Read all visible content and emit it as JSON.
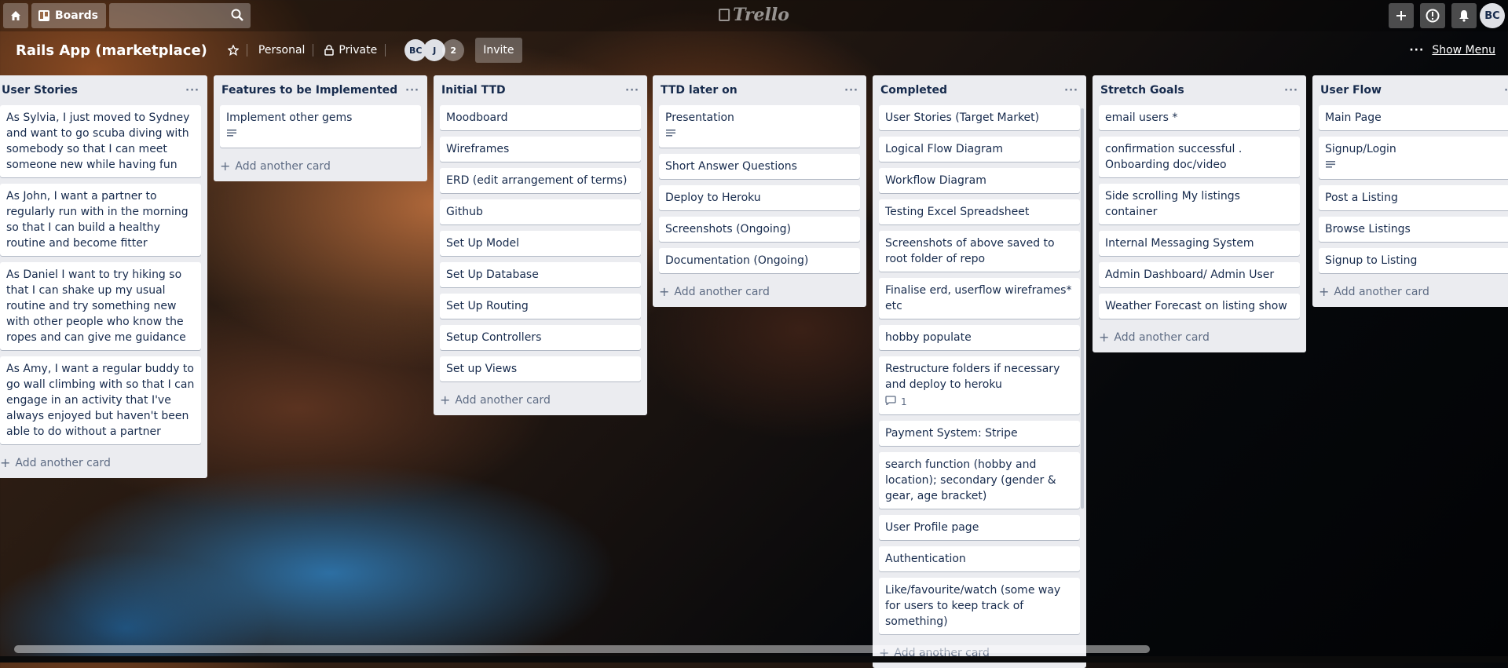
{
  "topbar": {
    "boards_label": "Boards",
    "logo_text": "Trello",
    "user_initials": "BC"
  },
  "board": {
    "title": "Rails App (marketplace)",
    "team": "Personal",
    "visibility": "Private",
    "members": [
      "BC",
      "J"
    ],
    "member_count": "2",
    "invite_label": "Invite",
    "show_menu_label": "Show Menu"
  },
  "add_card_label": "Add another card",
  "lists": [
    {
      "title": "User Stories",
      "cards": [
        {
          "text": "As Sylvia, I just moved to Sydney and want to go scuba diving with somebody so that I can meet someone new while having fun"
        },
        {
          "text": "As John, I want a partner to regularly run with in the morning so that I can build a healthy routine and become fitter"
        },
        {
          "text": "As Daniel I want to try hiking so that I can shake up my usual routine and try something new with other people who know the ropes and can give me guidance"
        },
        {
          "text": "As Amy, I want a regular buddy to go wall climbing with so that I can engage in an activity that I've always enjoyed but haven't been able to do without a partner"
        }
      ]
    },
    {
      "title": "Features to be Implemented",
      "cards": [
        {
          "text": "Implement other gems",
          "description_icon": true
        }
      ]
    },
    {
      "title": "Initial TTD",
      "cards": [
        {
          "text": "Moodboard"
        },
        {
          "text": "Wireframes"
        },
        {
          "text": "ERD (edit arrangement of terms)"
        },
        {
          "text": "Github"
        },
        {
          "text": "Set Up Model"
        },
        {
          "text": "Set Up Database"
        },
        {
          "text": "Set Up Routing"
        },
        {
          "text": "Setup Controllers"
        },
        {
          "text": "Set up Views"
        }
      ]
    },
    {
      "title": "TTD later on",
      "cards": [
        {
          "text": "Presentation",
          "description_icon": true
        },
        {
          "text": "Short Answer Questions"
        },
        {
          "text": "Deploy to Heroku"
        },
        {
          "text": "Screenshots (Ongoing)"
        },
        {
          "text": "Documentation (Ongoing)"
        }
      ]
    },
    {
      "title": "Completed",
      "cards": [
        {
          "text": "User Stories (Target Market)"
        },
        {
          "text": "Logical Flow Diagram"
        },
        {
          "text": "Workflow Diagram"
        },
        {
          "text": "Testing Excel Spreadsheet"
        },
        {
          "text": "Screenshots of above saved to root folder of repo"
        },
        {
          "text": "Finalise erd, userflow wireframes* etc"
        },
        {
          "text": "hobby populate"
        },
        {
          "text": "Restructure folders if necessary and deploy to heroku",
          "comments": "1"
        },
        {
          "text": "Payment System: Stripe"
        },
        {
          "text": "search function (hobby and location); secondary (gender & gear, age bracket)"
        },
        {
          "text": "User Profile page"
        },
        {
          "text": "Authentication"
        },
        {
          "text": "Like/favourite/watch (some way for users to keep track of something)"
        }
      ]
    },
    {
      "title": "Stretch Goals",
      "cards": [
        {
          "text": "email users *"
        },
        {
          "text": "confirmation successful . Onboarding doc/video"
        },
        {
          "text": "Side scrolling My listings container"
        },
        {
          "text": "Internal Messaging System"
        },
        {
          "text": "Admin Dashboard/ Admin User"
        },
        {
          "text": "Weather Forecast on listing show"
        }
      ]
    },
    {
      "title": "User Flow",
      "cards": [
        {
          "text": "Main Page"
        },
        {
          "text": "Signup/Login",
          "description_icon": true
        },
        {
          "text": "Post a Listing"
        },
        {
          "text": "Browse Listings"
        },
        {
          "text": "Signup to Listing"
        }
      ]
    }
  ],
  "colors": {
    "list_bg": "#ebecf0",
    "card_bg": "#ffffff",
    "text": "#172b4d",
    "muted": "#5e6c84"
  },
  "icons": [
    "home-icon",
    "boards-icon",
    "search-icon",
    "plus-icon",
    "info-icon",
    "bell-icon",
    "star-icon",
    "lock-icon",
    "ellipsis-icon",
    "description-icon",
    "comment-icon"
  ]
}
